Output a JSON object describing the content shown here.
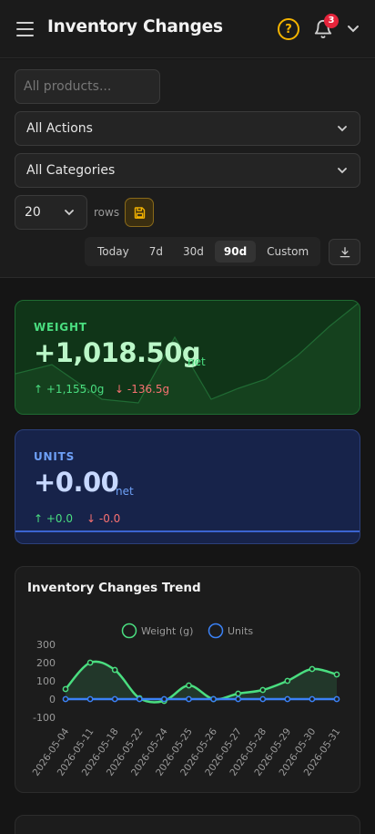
{
  "header": {
    "title": "Inventory Changes",
    "help_icon": "help-circle-icon",
    "notification_count": "3"
  },
  "filters": {
    "search_placeholder": "All products...",
    "action_select": "All Actions",
    "category_select": "All Categories",
    "rows_value": "20",
    "rows_label": "rows",
    "ranges": [
      "Today",
      "7d",
      "30d",
      "90d",
      "Custom"
    ],
    "active_range": "90d"
  },
  "weight_card": {
    "label": "WEIGHT",
    "value": "+1,018.50g",
    "net": "net",
    "up": "+1,155.0g",
    "down": "-136.5g",
    "color": "#4ade80"
  },
  "units_card": {
    "label": "UNITS",
    "value": "+0.00",
    "net": "net",
    "up": "+0.0",
    "down": "-0.0",
    "color": "#6ea0f7"
  },
  "chart": {
    "title": "Inventory Changes Trend"
  },
  "chart_data": {
    "type": "line",
    "title": "Inventory Changes Trend",
    "categories": [
      "2026-05-04",
      "2026-05-11",
      "2026-05-18",
      "2026-05-22",
      "2026-05-24",
      "2026-05-25",
      "2026-05-26",
      "2026-05-27",
      "2026-05-28",
      "2026-05-29",
      "2026-05-30",
      "2026-05-31"
    ],
    "series": [
      {
        "name": "Weight (g)",
        "color": "#4ade80",
        "values": [
          55,
          200,
          160,
          5,
          -10,
          75,
          0,
          30,
          50,
          100,
          165,
          135
        ]
      },
      {
        "name": "Units",
        "color": "#3b82f6",
        "values": [
          0,
          0,
          0,
          0,
          0,
          0,
          0,
          0,
          0,
          0,
          0,
          0
        ]
      }
    ],
    "y_ticks": [
      300,
      200,
      100,
      0,
      -100
    ],
    "ylim": [
      -100,
      300
    ],
    "legend": "top-center",
    "grid": false
  }
}
